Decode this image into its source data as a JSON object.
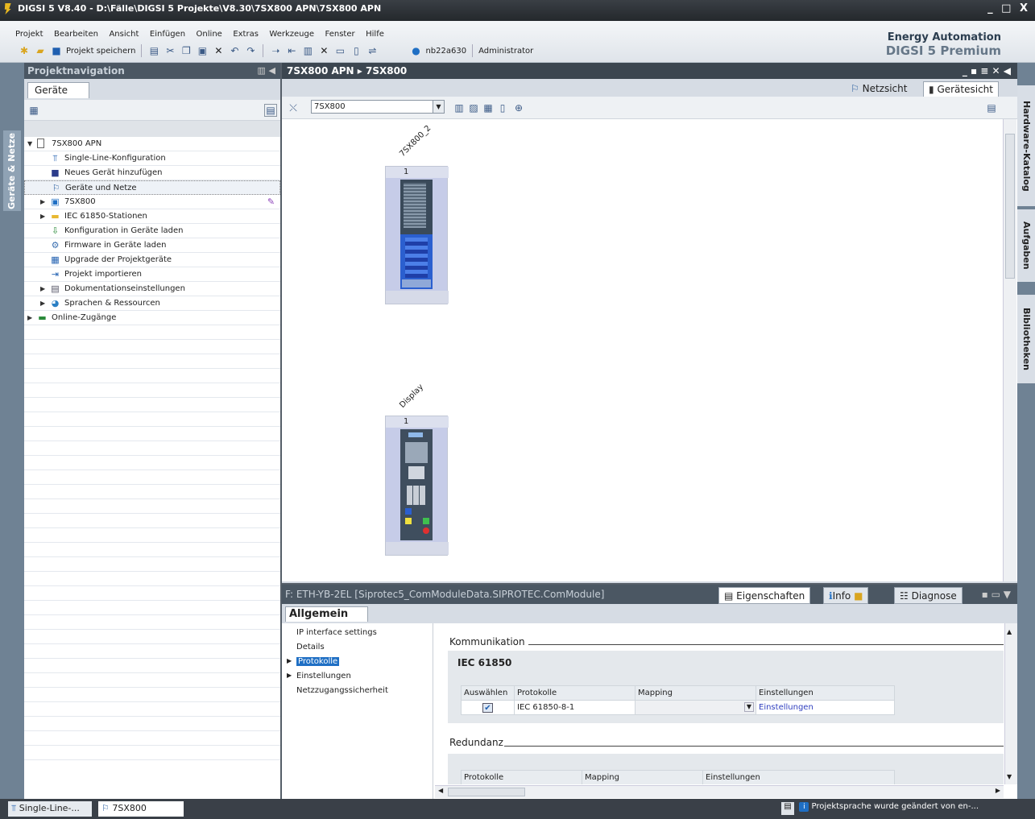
{
  "window": {
    "title": "DIGSI 5 V8.40 - D:\\Fälle\\DIGSI 5 Projekte\\V8.30\\7SX800 APN\\7SX800 APN",
    "controls": "_ □ X"
  },
  "menu": [
    "Projekt",
    "Bearbeiten",
    "Ansicht",
    "Einfügen",
    "Online",
    "Extras",
    "Werkzeuge",
    "Fenster",
    "Hilfe"
  ],
  "toolbar": {
    "save_label": "Projekt speichern",
    "user": "nb22a630",
    "role": "Administrator"
  },
  "brand": {
    "line1": "Energy Automation",
    "line2": "DIGSI 5 Premium"
  },
  "left_strip": {
    "tab": "Geräte & Netze"
  },
  "project_nav": {
    "title": "Projektnavigation",
    "tab": "Geräte",
    "tree": [
      {
        "label": "7SX800 APN",
        "icon": "project-icon"
      },
      {
        "label": "Single-Line-Konfiguration",
        "icon": "single-line-icon"
      },
      {
        "label": "Neues Gerät hinzufügen",
        "icon": "add-device-icon"
      },
      {
        "label": "Geräte und Netze",
        "icon": "network-icon"
      },
      {
        "label": "7SX800",
        "icon": "device-icon"
      },
      {
        "label": "IEC 61850-Stationen",
        "icon": "folder-icon"
      },
      {
        "label": "Konfiguration in Geräte laden",
        "icon": "load-config-icon"
      },
      {
        "label": "Firmware in Geräte laden",
        "icon": "firmware-icon"
      },
      {
        "label": "Upgrade der Projektgeräte",
        "icon": "upgrade-icon"
      },
      {
        "label": "Projekt importieren",
        "icon": "import-icon"
      },
      {
        "label": "Dokumentationseinstellungen",
        "icon": "docs-icon"
      },
      {
        "label": "Sprachen & Ressourcen",
        "icon": "language-icon"
      },
      {
        "label": "Online-Zugänge",
        "icon": "online-icon"
      }
    ]
  },
  "editor": {
    "breadcrumb": "7SX800 APN  ▸  7SX800",
    "views": {
      "network": "Netzsicht",
      "device": "Gerätesicht"
    },
    "device_combo": "7SX800",
    "devices": [
      {
        "name": "7SX800_2",
        "slot": "1"
      },
      {
        "name": "Display",
        "slot": "1"
      }
    ]
  },
  "right_tabs": [
    "Hardware-Katalog",
    "Aufgaben",
    "Bibliotheken"
  ],
  "inspector": {
    "title": "F: ETH-YB-2EL [Siprotec5_ComModuleData.SIPROTEC.ComModule]",
    "tabs": {
      "properties": "Eigenschaften",
      "info": "Info",
      "diagnose": "Diagnose"
    },
    "subtab": "Allgemein",
    "nav": [
      "IP interface settings",
      "Details",
      "Protokolle",
      "Einstellungen",
      "Netzzugangssicherheit"
    ],
    "section1": "Kommunikation",
    "section1_sub": "IEC 61850",
    "table1": {
      "headers": [
        "Auswählen",
        "Protokolle",
        "Mapping",
        "Einstellungen"
      ],
      "rows": [
        {
          "select": "✔",
          "protocol": "IEC 61850-8-1",
          "mapping": "",
          "settings": "Einstellungen"
        }
      ]
    },
    "section2": "Redundanz",
    "table2": {
      "headers": [
        "Protokolle",
        "Mapping",
        "Einstellungen"
      ]
    }
  },
  "taskbar": {
    "task1": "Single-Line-...",
    "task2": "7SX800",
    "status": "Projektsprache wurde geändert von en-..."
  },
  "colors": {
    "accent": "#1f6fc4",
    "header": "#4b5763",
    "brand": "#2c3e50"
  }
}
